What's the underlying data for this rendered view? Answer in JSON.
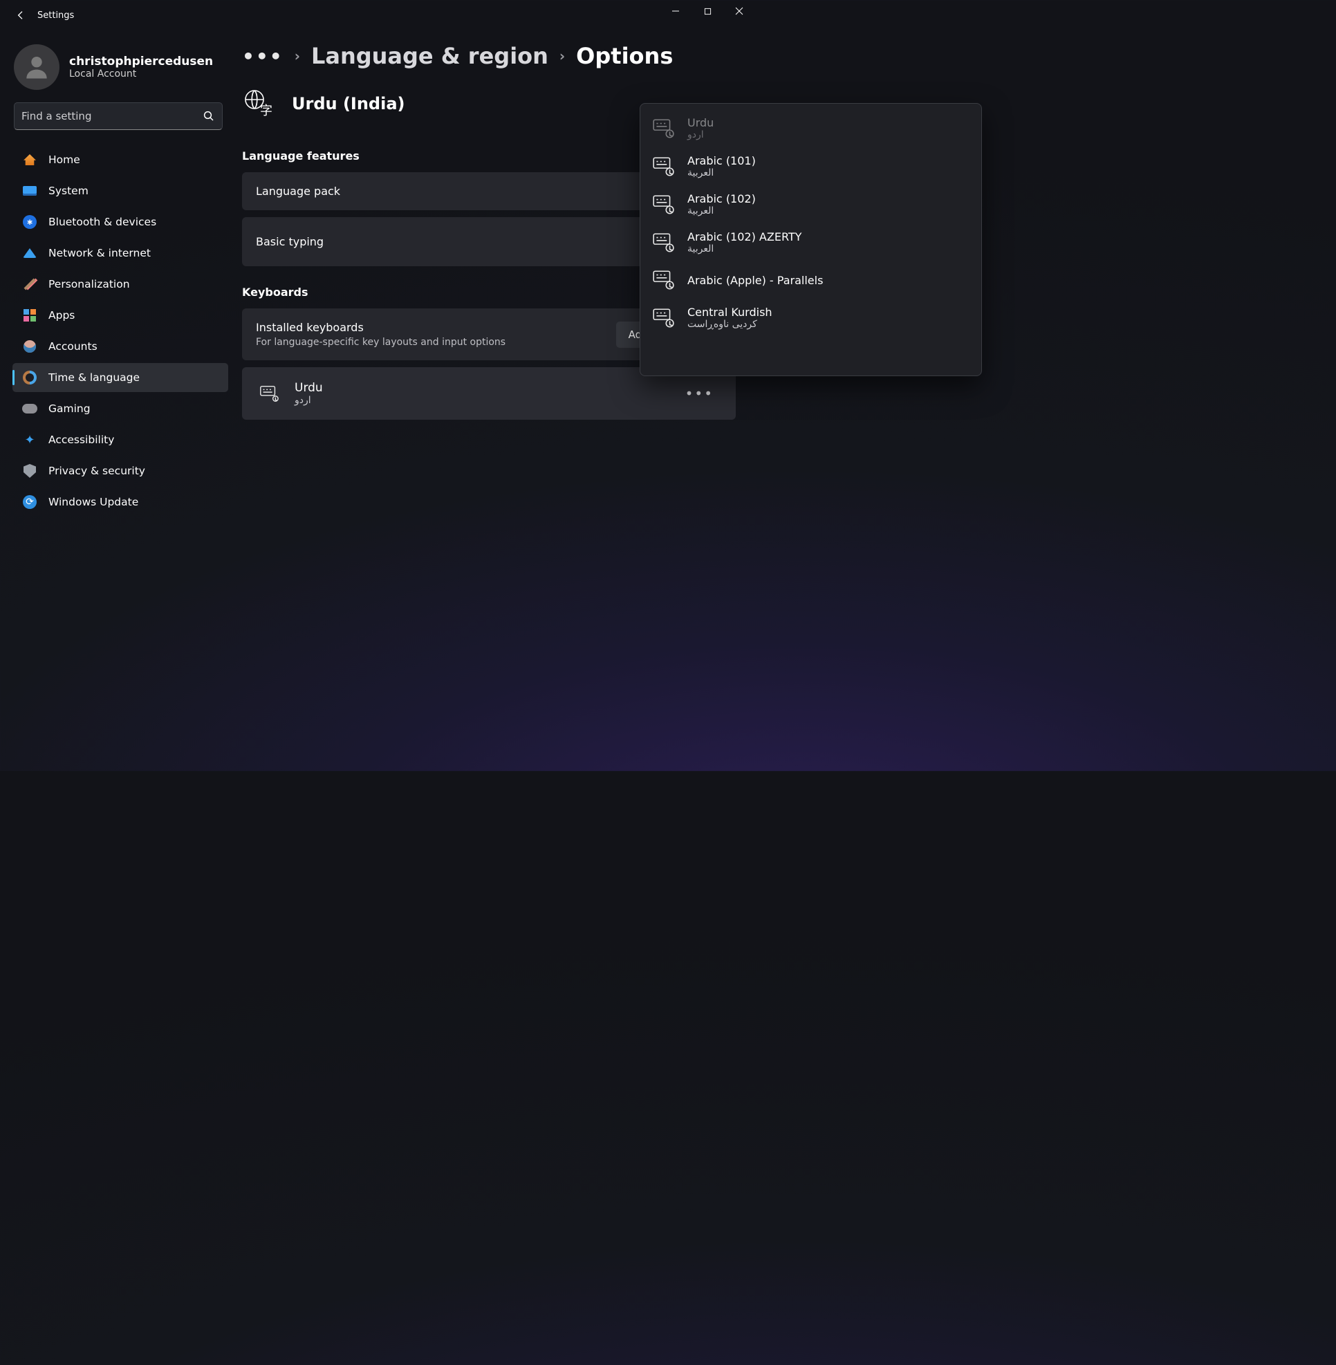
{
  "titlebar": {
    "title": "Settings"
  },
  "profile": {
    "name": "christophpiercedusen",
    "sub": "Local Account"
  },
  "search": {
    "placeholder": "Find a setting"
  },
  "nav": {
    "items": [
      {
        "label": "Home"
      },
      {
        "label": "System"
      },
      {
        "label": "Bluetooth & devices"
      },
      {
        "label": "Network & internet"
      },
      {
        "label": "Personalization"
      },
      {
        "label": "Apps"
      },
      {
        "label": "Accounts"
      },
      {
        "label": "Time & language"
      },
      {
        "label": "Gaming"
      },
      {
        "label": "Accessibility"
      },
      {
        "label": "Privacy & security"
      },
      {
        "label": "Windows Update"
      }
    ],
    "activeIndex": 7
  },
  "breadcrumb": {
    "link": "Language & region",
    "current": "Options"
  },
  "languageHeader": {
    "title": "Urdu (India)"
  },
  "sections": {
    "features": {
      "title": "Language features",
      "items": [
        {
          "label": "Language pack"
        },
        {
          "label": "Basic typing"
        }
      ]
    },
    "keyboards": {
      "title": "Keyboards",
      "installed": {
        "title": "Installed keyboards",
        "sub": "For language-specific key layouts and input options",
        "addButton": "Add a keyboard"
      },
      "list": [
        {
          "name": "Urdu",
          "native": "اردو"
        }
      ]
    }
  },
  "popup": {
    "items": [
      {
        "name": "Urdu",
        "native": "اردو",
        "disabled": true
      },
      {
        "name": "Arabic (101)",
        "native": "العربية"
      },
      {
        "name": "Arabic (102)",
        "native": "العربية"
      },
      {
        "name": "Arabic (102) AZERTY",
        "native": "العربية"
      },
      {
        "name": "Arabic (Apple) - Parallels",
        "native": ""
      },
      {
        "name": "Central Kurdish",
        "native": "کردیی ناوەڕاست"
      }
    ]
  }
}
